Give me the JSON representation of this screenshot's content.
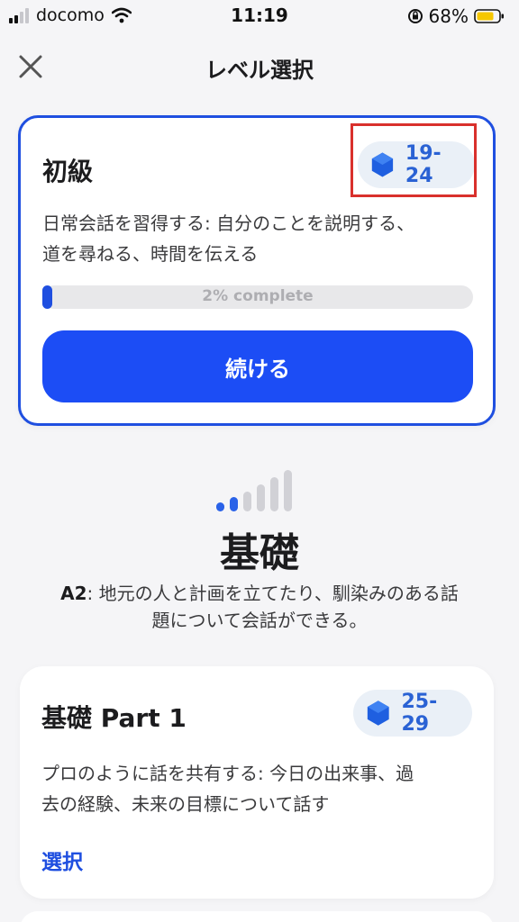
{
  "status_bar": {
    "carrier": "docomo",
    "time": "11:19",
    "battery": "68%",
    "signal_bars_active": 2,
    "signal_bars_total": 4
  },
  "nav": {
    "title": "レベル選択",
    "close_icon": "close-icon"
  },
  "current_card": {
    "title": "初級",
    "badge": "19-24",
    "description_lines": [
      "日常会話を習得する: 自分のことを説明する、",
      "道を尋ねる、時間を伝える"
    ],
    "progress_percent": 2,
    "progress_text": "2% complete",
    "button_label": "続ける"
  },
  "level": {
    "active_bars": 2,
    "total_bars": 6,
    "name": "基礎",
    "code": "A2",
    "description_line1": ": 地元の人と計画を立てたり、馴染みのある話",
    "description_line2": "題について会話ができる。"
  },
  "part_card": {
    "title": "基礎 Part 1",
    "badge": "25-29",
    "description_lines": [
      "プロのように話を共有する: 今日の出来事、過",
      "去の経験、未来の目標について話す"
    ],
    "link_label": "選択"
  },
  "colors": {
    "accent": "#1f4fe0",
    "button": "#1c4df5",
    "badge_bg": "#eaf0f7",
    "badge_text": "#2a62d4",
    "highlight": "#d9302c",
    "battery": "#f6c700"
  }
}
